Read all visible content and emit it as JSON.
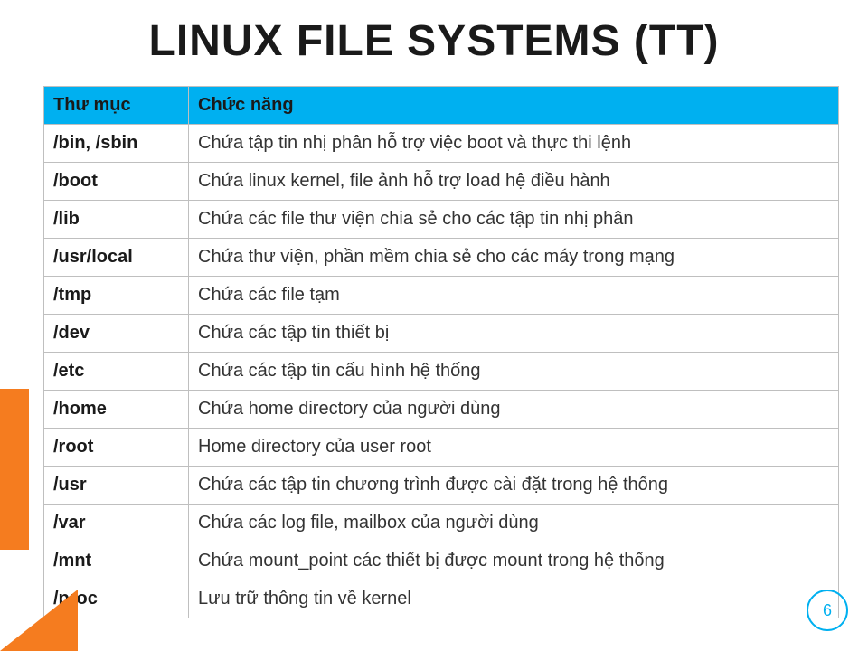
{
  "title": "LINUX FILE SYSTEMS (TT)",
  "headers": {
    "col1": "Thư mục",
    "col2": "Chức năng"
  },
  "rows": [
    {
      "dir": "/bin, /sbin",
      "func": "Chứa tập tin nhị phân hỗ trợ việc boot và thực thi lệnh"
    },
    {
      "dir": "/boot",
      "func": "Chứa linux kernel, file ảnh hỗ trợ load hệ điều hành"
    },
    {
      "dir": "/lib",
      "func": "Chứa các file thư viện chia sẻ cho các tập tin nhị phân"
    },
    {
      "dir": "/usr/local",
      "func": "Chứa thư viện, phần mềm chia sẻ cho các máy trong mạng"
    },
    {
      "dir": "/tmp",
      "func": "Chứa các file tạm"
    },
    {
      "dir": "/dev",
      "func": "Chứa các tập tin thiết bị"
    },
    {
      "dir": "/etc",
      "func": "Chứa các tập tin cấu hình hệ thống"
    },
    {
      "dir": "/home",
      "func": "Chứa home directory của người dùng"
    },
    {
      "dir": "/root",
      "func": "Home directory của user root"
    },
    {
      "dir": "/usr",
      "func": "Chứa các tập tin chương trình được cài đặt trong hệ thống"
    },
    {
      "dir": "/var",
      "func": "Chứa các log file, mailbox của người dùng"
    },
    {
      "dir": "/mnt",
      "func": "Chứa mount_point các thiết bị được mount trong hệ thống"
    },
    {
      "dir": "/proc",
      "func": "Lưu trữ thông tin về kernel"
    }
  ],
  "page_number": "6",
  "colors": {
    "accent_blue": "#00b0f0",
    "accent_orange": "#f57c1f"
  },
  "chart_data": {
    "type": "table",
    "columns": [
      "Thư mục",
      "Chức năng"
    ],
    "rows": [
      [
        "/bin, /sbin",
        "Chứa tập tin nhị phân hỗ trợ việc boot và thực thi lệnh"
      ],
      [
        "/boot",
        "Chứa linux kernel, file ảnh hỗ trợ load hệ điều hành"
      ],
      [
        "/lib",
        "Chứa các file thư viện chia sẻ cho các tập tin nhị phân"
      ],
      [
        "/usr/local",
        "Chứa thư viện, phần mềm chia sẻ cho các máy trong mạng"
      ],
      [
        "/tmp",
        "Chứa các file tạm"
      ],
      [
        "/dev",
        "Chứa các tập tin thiết bị"
      ],
      [
        "/etc",
        "Chứa các tập tin cấu hình hệ thống"
      ],
      [
        "/home",
        "Chứa home directory của người dùng"
      ],
      [
        "/root",
        "Home directory của user root"
      ],
      [
        "/usr",
        "Chứa các tập tin chương trình được cài đặt trong hệ thống"
      ],
      [
        "/var",
        "Chứa các log file, mailbox của người dùng"
      ],
      [
        "/mnt",
        "Chứa mount_point các thiết bị được mount trong hệ thống"
      ],
      [
        "/proc",
        "Lưu trữ thông tin về kernel"
      ]
    ]
  }
}
